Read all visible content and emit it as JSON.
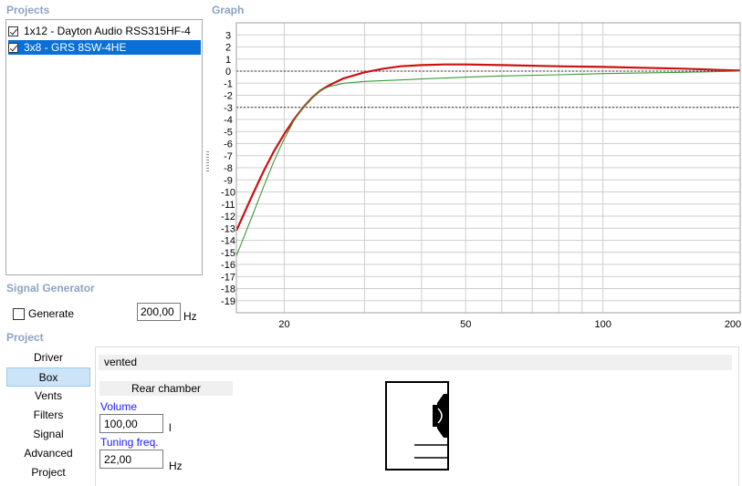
{
  "sections": {
    "projects": "Projects",
    "graph": "Graph",
    "signal_generator": "Signal Generator",
    "project": "Project"
  },
  "projects": [
    {
      "label": "1x12 - Dayton Audio RSS315HF-4",
      "checked": true,
      "selected": false
    },
    {
      "label": "3x8 - GRS 8SW-4HE",
      "checked": true,
      "selected": true
    }
  ],
  "signal_generator": {
    "generate_label": "Generate",
    "generate_checked": false,
    "frequency": "200,00",
    "unit": "Hz"
  },
  "nav": {
    "items": [
      "Driver",
      "Box",
      "Vents",
      "Filters",
      "Signal",
      "Advanced",
      "Project"
    ],
    "active": "Box"
  },
  "box": {
    "type": "vented",
    "rear_chamber_label": "Rear chamber",
    "volume_label": "Volume",
    "volume_value": "100,00",
    "volume_unit": "l",
    "tuning_label": "Tuning freq.",
    "tuning_value": "22,00",
    "tuning_unit": "Hz"
  },
  "chart_data": {
    "type": "line",
    "x_scale": "log",
    "xlim": [
      15.7,
      200
    ],
    "ylim": [
      -20,
      4
    ],
    "x_ticks": [
      20,
      50,
      100,
      200
    ],
    "y_ticks": [
      3,
      2,
      1,
      0,
      -1,
      -2,
      -3,
      -4,
      -5,
      -6,
      -7,
      -8,
      -9,
      -10,
      -11,
      -12,
      -13,
      -14,
      -15,
      -16,
      -17,
      -18,
      -19
    ],
    "reference_lines": [
      0,
      -3
    ],
    "grid": true,
    "colors": {
      "series_red": "#cc1111",
      "series_green": "#3a9a3a",
      "reference": "#333333"
    },
    "series": [
      {
        "color": "#cc1111",
        "x": [
          15.7,
          17,
          18,
          19,
          20,
          21,
          22,
          23,
          24,
          25,
          27,
          30,
          33,
          36,
          40,
          45,
          50,
          60,
          80,
          100,
          150,
          180,
          200
        ],
        "y": [
          -13.2,
          -10.3,
          -8.3,
          -6.6,
          -5.2,
          -4.0,
          -3.0,
          -2.2,
          -1.6,
          -1.2,
          -0.6,
          -0.1,
          0.2,
          0.4,
          0.5,
          0.55,
          0.55,
          0.5,
          0.4,
          0.35,
          0.2,
          0.1,
          0.05
        ]
      },
      {
        "color": "#3a9a3a",
        "x": [
          15.7,
          17,
          18,
          19,
          20,
          21,
          22,
          23,
          24,
          25,
          27,
          30,
          35,
          40,
          50,
          60,
          80,
          100,
          150,
          200
        ],
        "y": [
          -15.3,
          -12.0,
          -9.6,
          -7.4,
          -5.6,
          -4.1,
          -3.0,
          -2.2,
          -1.6,
          -1.3,
          -1.0,
          -0.85,
          -0.75,
          -0.65,
          -0.5,
          -0.4,
          -0.3,
          -0.2,
          -0.1,
          0.0
        ]
      }
    ]
  }
}
